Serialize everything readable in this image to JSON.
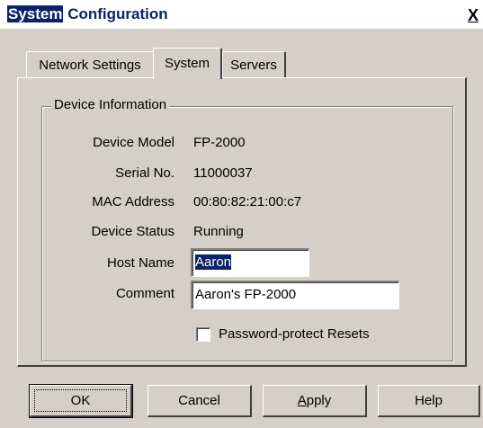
{
  "window": {
    "title_highlighted": "System",
    "title_rest": " Configuration",
    "close_glyph": "X"
  },
  "tabs": [
    {
      "label": "Network Settings",
      "active": false
    },
    {
      "label": "System",
      "active": true
    },
    {
      "label": "Servers",
      "active": false
    }
  ],
  "device_info": {
    "group_label": "Device Information",
    "rows": [
      {
        "label": "Device Model",
        "value": "FP-2000"
      },
      {
        "label": "Serial No.",
        "value": "11000037"
      },
      {
        "label": "MAC Address",
        "value": "00:80:82:21:00:c7"
      },
      {
        "label": "Device Status",
        "value": "Running"
      }
    ],
    "host_name": {
      "label": "Host Name",
      "value": "Aaron"
    },
    "comment": {
      "label": "Comment",
      "value": "Aaron's FP-2000"
    },
    "password_protect": {
      "label": "Password-protect Resets",
      "checked": false
    }
  },
  "buttons": {
    "ok": "OK",
    "cancel": "Cancel",
    "apply_mnemonic": "A",
    "apply_rest": "pply",
    "help": "Help"
  },
  "colors": {
    "dialog_bg": "#d4d0c8",
    "title_highlight": "#0a246a"
  }
}
